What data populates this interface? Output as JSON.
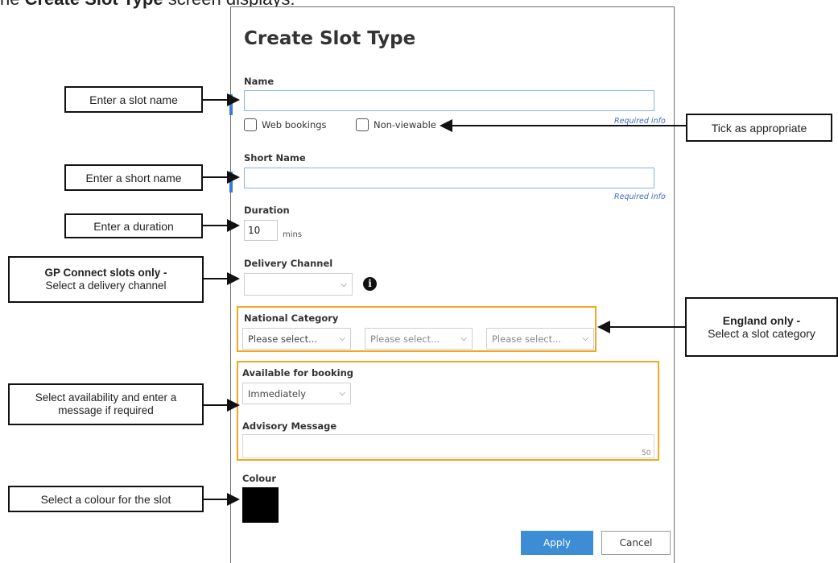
{
  "intro": {
    "prefix": "he ",
    "bold": "Create Slot Type",
    "suffix": " screen displays:"
  },
  "dialog": {
    "title": "Create Slot Type",
    "name": {
      "label": "Name",
      "value": "",
      "required": "Required info"
    },
    "checkboxes": {
      "web_bookings": "Web bookings",
      "non_viewable": "Non-viewable"
    },
    "short_name": {
      "label": "Short Name",
      "value": "",
      "required": "Required info"
    },
    "duration": {
      "label": "Duration",
      "value": "10",
      "unit": "mins"
    },
    "delivery_channel": {
      "label": "Delivery Channel",
      "value": ""
    },
    "national_category": {
      "label": "National Category",
      "selects": [
        "Please select...",
        "Please select...",
        "Please select..."
      ]
    },
    "available_for_booking": {
      "label": "Available for booking",
      "value": "Immediately"
    },
    "advisory_message": {
      "label": "Advisory Message",
      "value": "",
      "count": "50"
    },
    "colour": {
      "label": "Colour",
      "value": "#000000"
    },
    "buttons": {
      "apply": "Apply",
      "cancel": "Cancel"
    }
  },
  "callouts": {
    "slot_name": "Enter a slot name",
    "short_name": "Enter a short name",
    "duration": "Enter a duration",
    "delivery_bold": "GP Connect slots only -",
    "delivery_text": "Select a delivery channel",
    "availability": "Select availability and enter a message if required",
    "colour": "Select a colour for the slot",
    "tick": "Tick as appropriate",
    "england_bold": "England only -",
    "england_text": "Select a slot category"
  },
  "colors": {
    "accent": "#3a7bd5",
    "highlight": "#f0a823",
    "apply": "#3d8cd6"
  }
}
